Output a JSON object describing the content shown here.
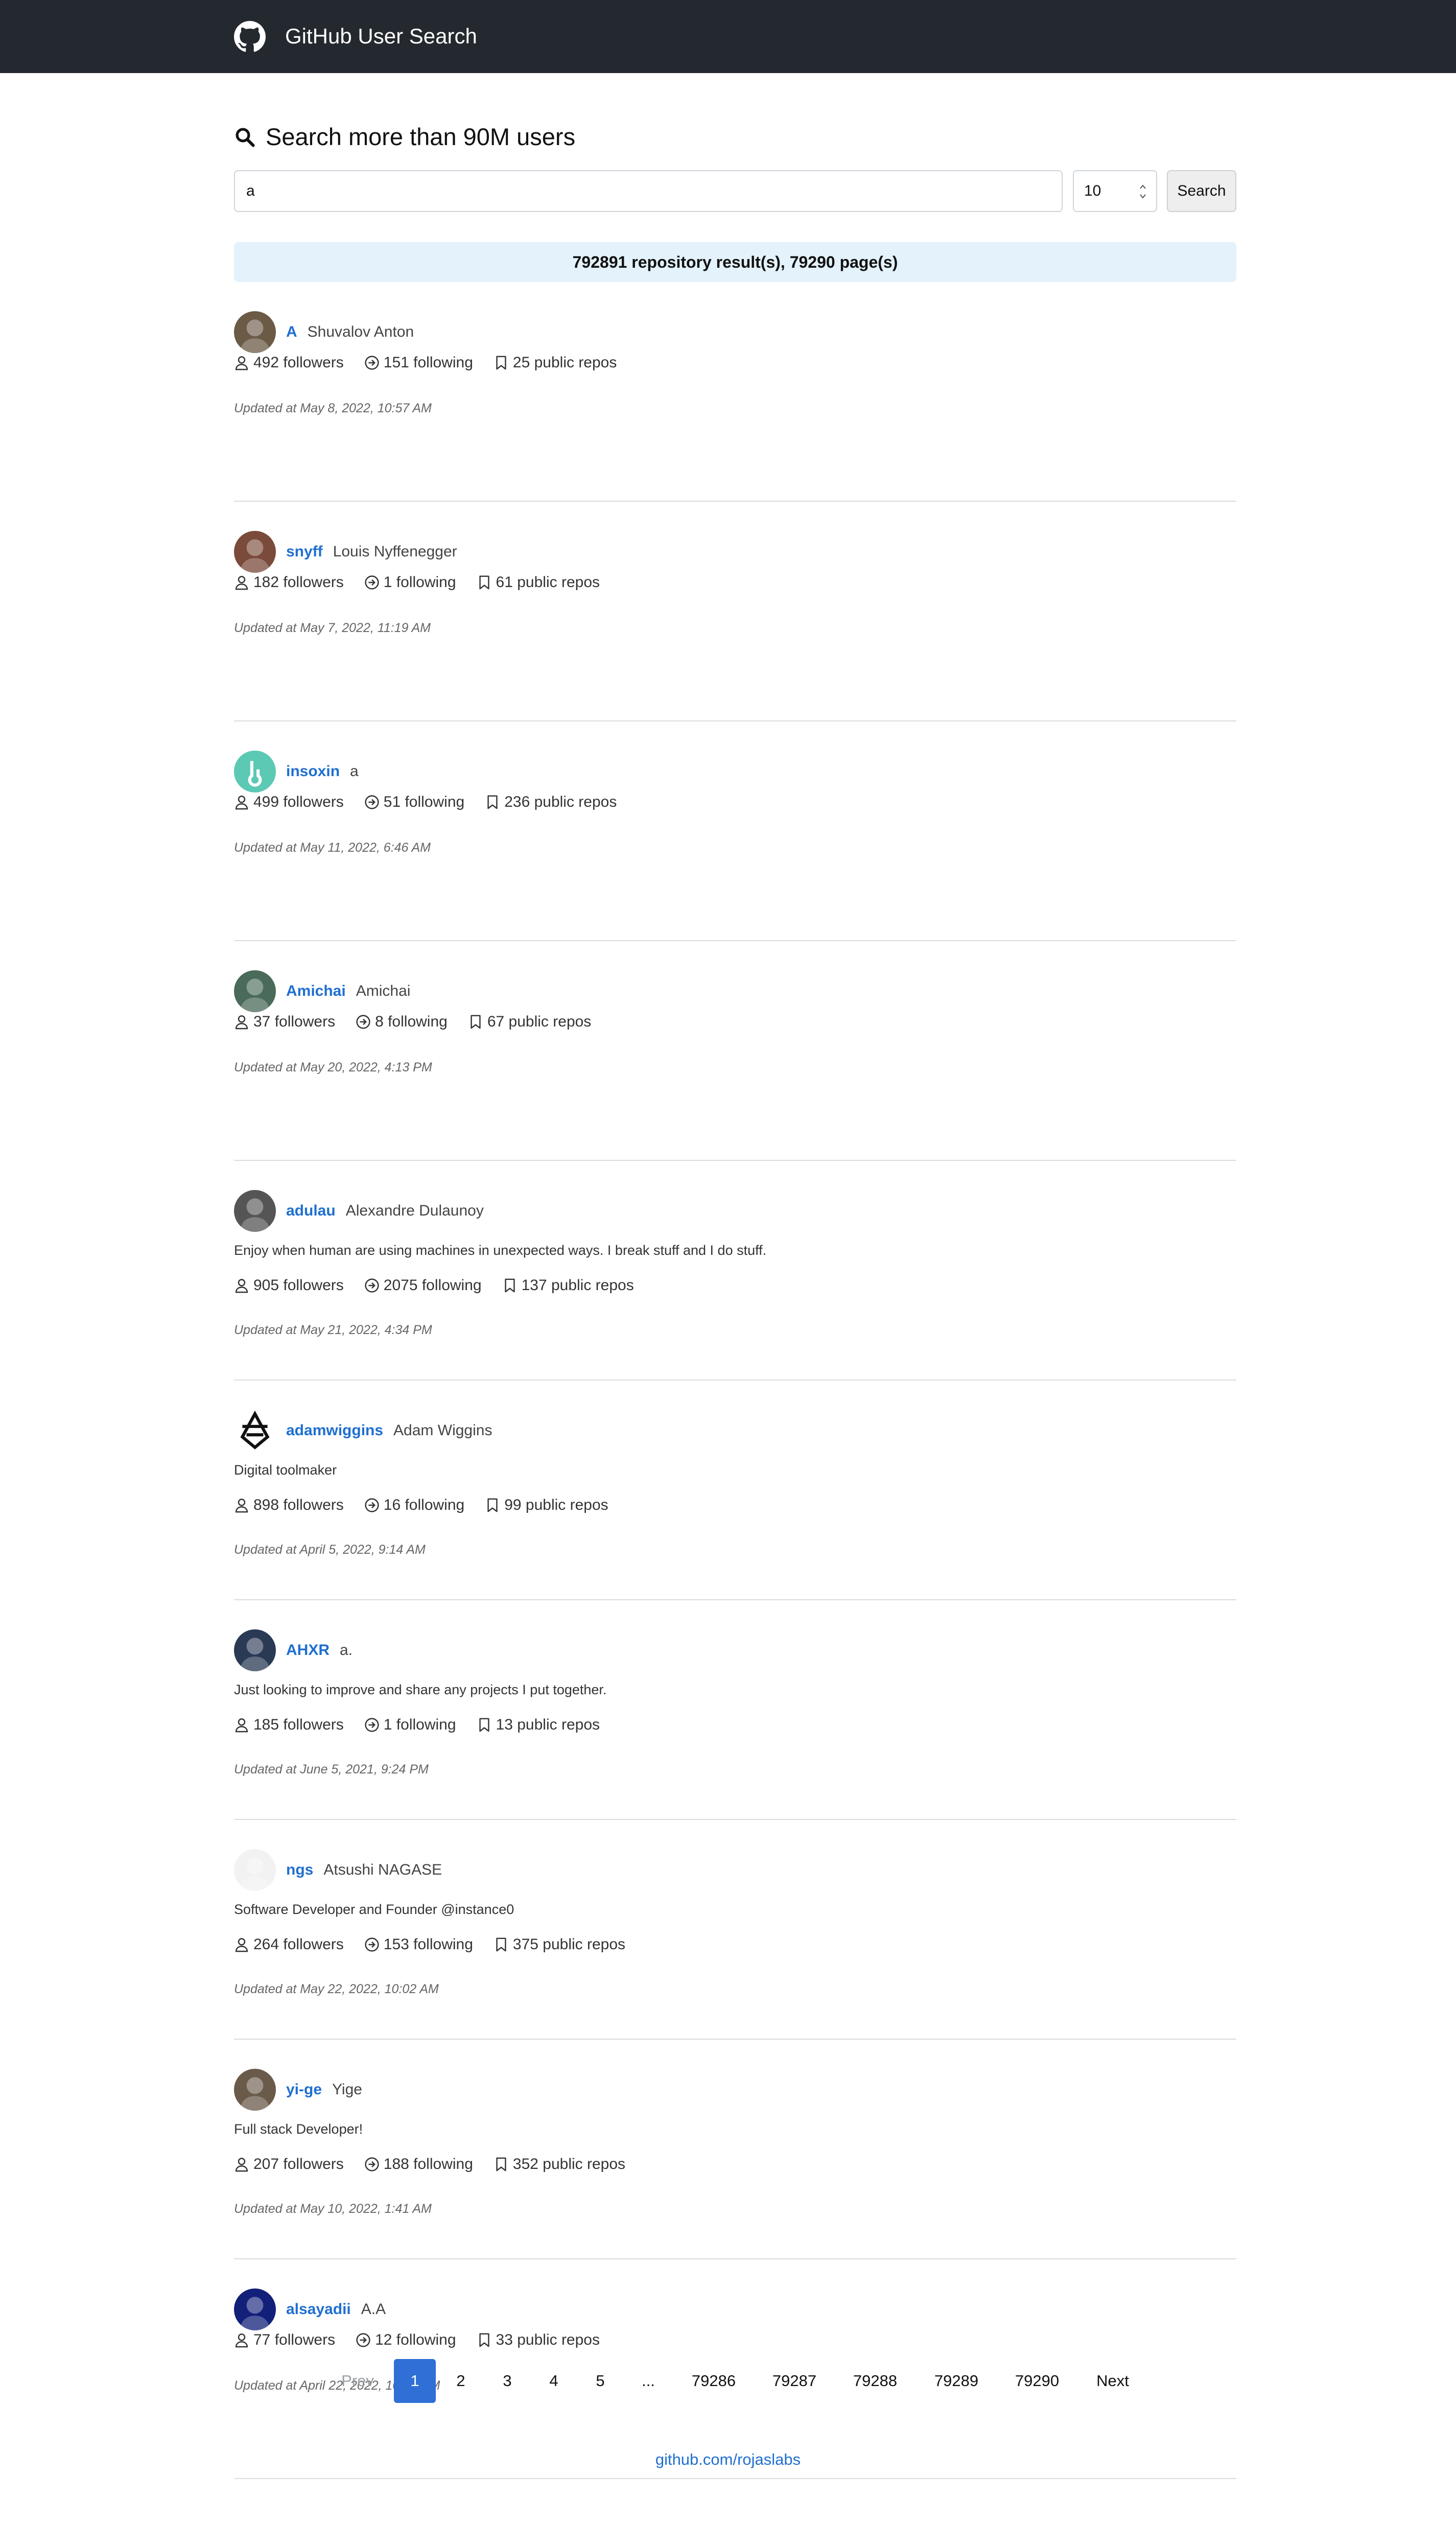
{
  "header": {
    "title": "GitHub User Search",
    "logo_icon": "github-octocat-icon"
  },
  "search": {
    "heading": "Search more than 90M users",
    "query": "a",
    "per_page": "10",
    "button_label": "Search"
  },
  "results_summary": "792891 repository result(s), 79290 page(s)",
  "users": [
    {
      "login": "A",
      "name": "Shuvalov Anton",
      "bio": "",
      "followers": "492 followers",
      "following": "151 following",
      "repos": "25 public repos",
      "updated": "Updated at May 8, 2022, 10:57 AM",
      "avatar_color": "#6b5a45"
    },
    {
      "login": "snyff",
      "name": "Louis Nyffenegger",
      "bio": "",
      "followers": "182 followers",
      "following": "1 following",
      "repos": "61 public repos",
      "updated": "Updated at May 7, 2022, 11:19 AM",
      "avatar_color": "#7a4a3a"
    },
    {
      "login": "insoxin",
      "name": "a",
      "bio": "",
      "followers": "499 followers",
      "following": "51 following",
      "repos": "236 public repos",
      "updated": "Updated at May 11, 2022, 6:46 AM",
      "avatar_color": "#5bc9b4"
    },
    {
      "login": "Amichai",
      "name": "Amichai",
      "bio": "",
      "followers": "37 followers",
      "following": "8 following",
      "repos": "67 public repos",
      "updated": "Updated at May 20, 2022, 4:13 PM",
      "avatar_color": "#4a6a5a"
    },
    {
      "login": "adulau",
      "name": "Alexandre Dulaunoy",
      "bio": "Enjoy when human are using machines in unexpected ways. I break stuff and I do stuff.",
      "followers": "905 followers",
      "following": "2075 following",
      "repos": "137 public repos",
      "updated": "Updated at May 21, 2022, 4:34 PM",
      "avatar_color": "#555555"
    },
    {
      "login": "adamwiggins",
      "name": "Adam Wiggins",
      "bio": "Digital toolmaker",
      "followers": "898 followers",
      "following": "16 following",
      "repos": "99 public repos",
      "updated": "Updated at April 5, 2022, 9:14 AM",
      "avatar_color": "#ffffff"
    },
    {
      "login": "AHXR",
      "name": "a.",
      "bio": "Just looking to improve and share any projects I put together.",
      "followers": "185 followers",
      "following": "1 following",
      "repos": "13 public repos",
      "updated": "Updated at June 5, 2021, 9:24 PM",
      "avatar_color": "#2a3a55"
    },
    {
      "login": "ngs",
      "name": "Atsushi NAGASE",
      "bio": "Software Developer and Founder @instance0",
      "followers": "264 followers",
      "following": "153 following",
      "repos": "375 public repos",
      "updated": "Updated at May 22, 2022, 10:02 AM",
      "avatar_color": "#f2f2f2"
    },
    {
      "login": "yi-ge",
      "name": "Yige",
      "bio": "Full stack Developer!",
      "followers": "207 followers",
      "following": "188 following",
      "repos": "352 public repos",
      "updated": "Updated at May 10, 2022, 1:41 AM",
      "avatar_color": "#6a5a4a"
    },
    {
      "login": "alsayadii",
      "name": "A.A",
      "bio": "",
      "followers": "77 followers",
      "following": "12 following",
      "repos": "33 public repos",
      "updated": "Updated at April 22, 2022, 10:30 PM",
      "avatar_color": "#12207a"
    }
  ],
  "pagination": {
    "prev": "Prev",
    "pages": [
      "1",
      "2",
      "3",
      "4",
      "5",
      "...",
      "79286",
      "79287",
      "79288",
      "79289",
      "79290"
    ],
    "next": "Next",
    "active": "1"
  },
  "footer": {
    "link": "github.com/rojaslabs"
  },
  "colors": {
    "header_bg": "#24292f",
    "link": "#1f6fd1",
    "active_page": "#2f6fd6",
    "banner_bg": "#e3f2fb"
  }
}
